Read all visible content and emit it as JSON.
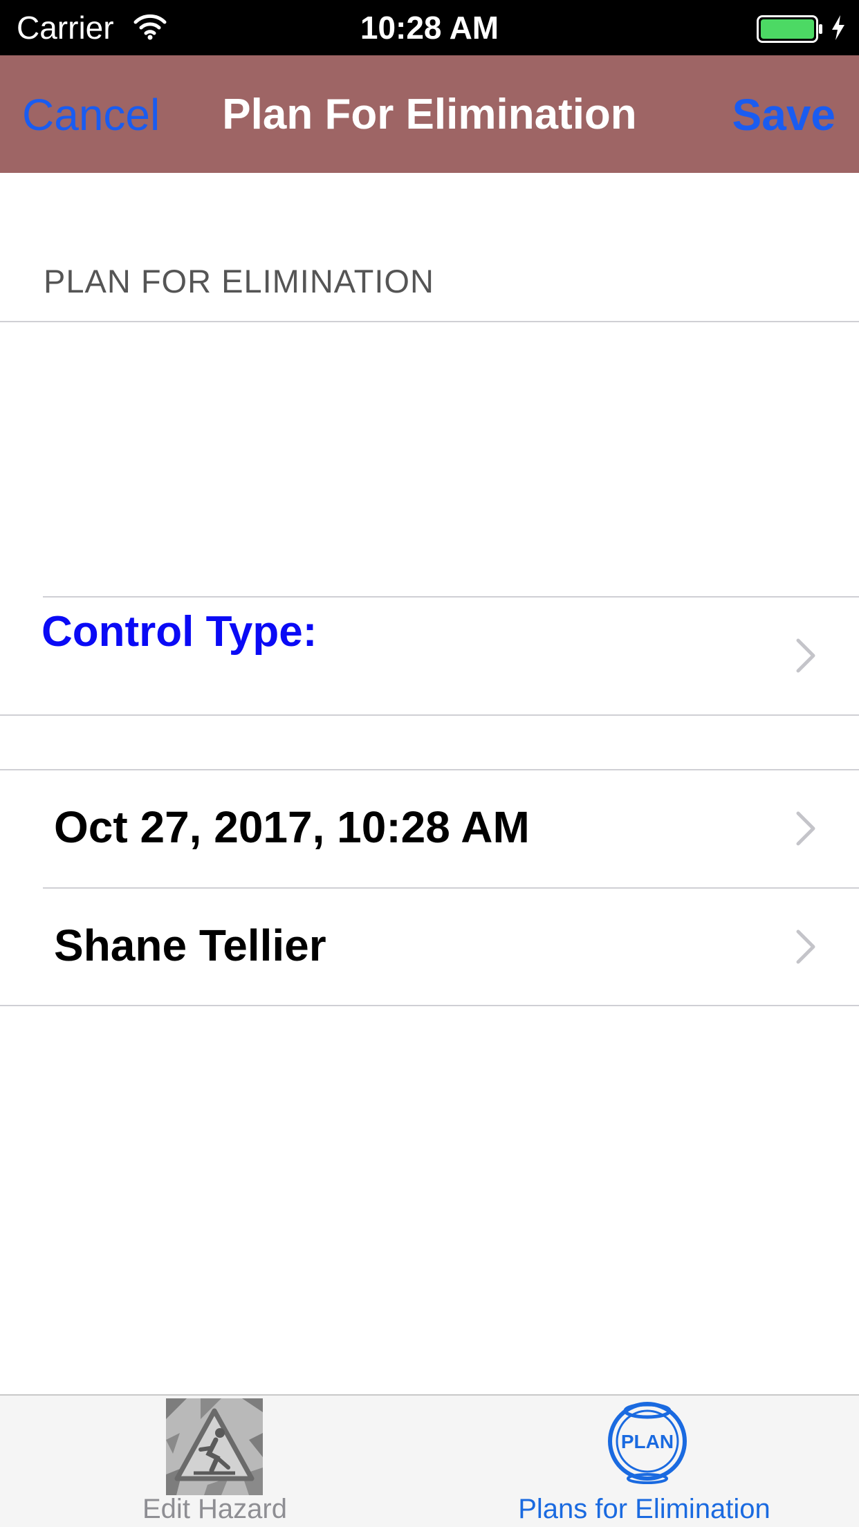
{
  "status_bar": {
    "carrier": "Carrier",
    "time": "10:28 AM",
    "battery_color": "#4cd964"
  },
  "nav": {
    "cancel_label": "Cancel",
    "title": "Plan For Elimination",
    "save_label": "Save",
    "background_color": "#9e6565",
    "button_color": "#1a5cf0"
  },
  "form": {
    "section_header": "PLAN FOR ELIMINATION",
    "plan_text": "",
    "control_type_label": "Control Type:",
    "date_value": "Oct 27, 2017, 10:28 AM",
    "person_value": "Shane Tellier"
  },
  "tab_bar": {
    "tabs": [
      {
        "label": "Edit Hazard",
        "icon": "hazard-icon",
        "selected": false
      },
      {
        "label": "Plans for Elimination",
        "icon": "plan-icon",
        "icon_text": "PLAN",
        "selected": true
      }
    ]
  }
}
